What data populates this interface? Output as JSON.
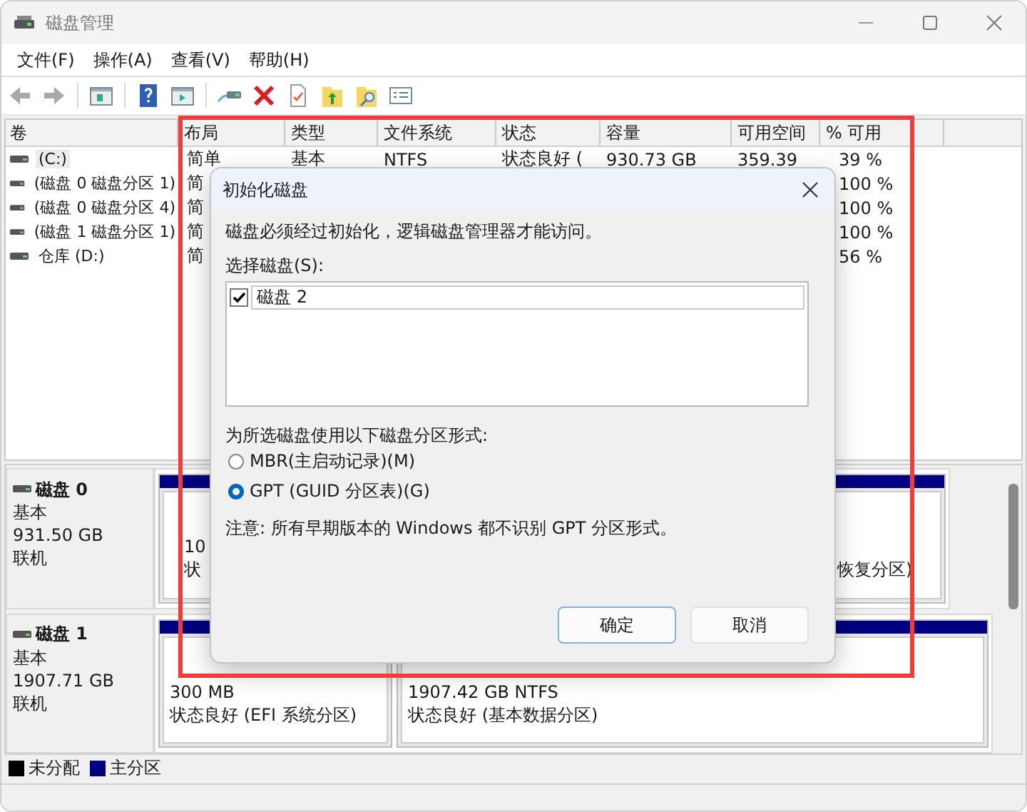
{
  "window": {
    "title": "磁盘管理"
  },
  "menu": [
    {
      "label": "文件(F)"
    },
    {
      "label": "操作(A)"
    },
    {
      "label": "查看(V)"
    },
    {
      "label": "帮助(H)"
    }
  ],
  "toolbar": [
    {
      "kind": "back",
      "disabled": true
    },
    {
      "kind": "forward",
      "disabled": true
    },
    {
      "kind": "separator"
    },
    {
      "kind": "tree"
    },
    {
      "kind": "separator"
    },
    {
      "kind": "help"
    },
    {
      "kind": "pane"
    },
    {
      "kind": "separator"
    },
    {
      "kind": "connect"
    },
    {
      "kind": "delete"
    },
    {
      "kind": "check"
    },
    {
      "kind": "folder-up"
    },
    {
      "kind": "folder-search"
    },
    {
      "kind": "list"
    }
  ],
  "volume_table": {
    "columns": [
      "卷",
      "布局",
      "类型",
      "文件系统",
      "状态",
      "容量",
      "可用空间",
      "% 可用"
    ],
    "rows": [
      {
        "selected": true,
        "cells": [
          "(C:)",
          "简单",
          "基本",
          "NTFS",
          "状态良好 (",
          "930.73 GB",
          "359.39",
          "39 %"
        ]
      },
      {
        "selected": false,
        "cells": [
          "(磁盘 0 磁盘分区 1)",
          "简",
          "",
          "",
          "",
          "",
          "",
          "100 %"
        ]
      },
      {
        "selected": false,
        "cells": [
          "(磁盘 0 磁盘分区 4)",
          "简",
          "",
          "",
          "",
          "",
          "",
          "100 %"
        ]
      },
      {
        "selected": false,
        "cells": [
          "(磁盘 1 磁盘分区 1)",
          "简",
          "",
          "",
          "",
          "",
          "",
          "100 %"
        ]
      },
      {
        "selected": false,
        "cells": [
          "仓库 (D:)",
          "简",
          "",
          "",
          "",
          "",
          "",
          "56 %"
        ]
      }
    ]
  },
  "disks": [
    {
      "name": "磁盘 0",
      "type": "基本",
      "size": "931.50 GB",
      "state": "联机",
      "partitions": [
        {
          "size": "10",
          "status": "状"
        },
        {
          "status": "恢复分区)"
        }
      ]
    },
    {
      "name": "磁盘 1",
      "type": "基本",
      "size": "1907.71 GB",
      "state": "联机",
      "partitions": [
        {
          "size": "300 MB",
          "status": "状态良好 (EFI 系统分区)"
        },
        {
          "size": "1907.42 GB NTFS",
          "status": "状态良好 (基本数据分区)"
        }
      ]
    }
  ],
  "legend": [
    {
      "label": "未分配",
      "color": "#000000"
    },
    {
      "label": "主分区",
      "color": "#000080"
    }
  ],
  "dialog": {
    "title": "初始化磁盘",
    "message": "磁盘必须经过初始化，逻辑磁盘管理器才能访问。",
    "select_label": "选择磁盘(S):",
    "disks": [
      {
        "label": "磁盘 2",
        "checked": true
      }
    ],
    "style_label": "为所选磁盘使用以下磁盘分区形式:",
    "styles": [
      {
        "label": "MBR(主启动记录)(M)",
        "selected": false
      },
      {
        "label": "GPT (GUID 分区表)(G)",
        "selected": true
      }
    ],
    "note": "注意: 所有早期版本的 Windows 都不识别 GPT 分区形式。",
    "buttons": [
      {
        "label": "确定",
        "default": true
      },
      {
        "label": "取消",
        "default": false
      }
    ]
  }
}
